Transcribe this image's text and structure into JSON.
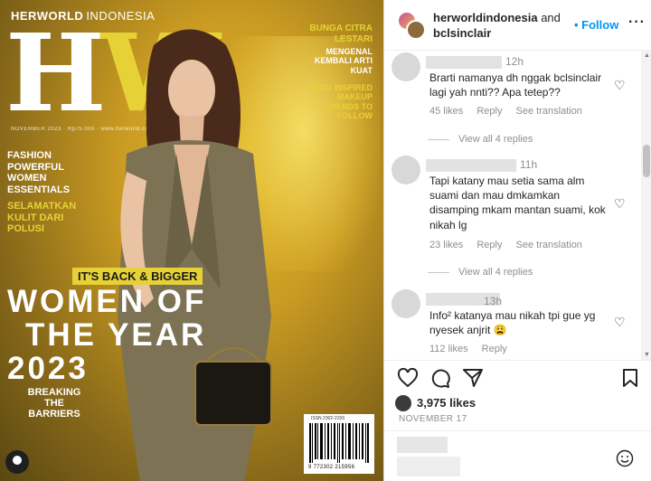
{
  "cover": {
    "brand_top": "HERWORLD",
    "brand_top_light": "INDONESIA",
    "logo_h": "H",
    "logo_w": "W",
    "issue_line": "NOVEMBER 2023 · Rp75.000 · www.herworld.co.id",
    "teaser_right_1": "BUNGA CITRA LESTARI",
    "teaser_right_2": "MENGENAL KEMBALI ARTI KUAT",
    "teaser_right_3": "FOOD INSPIRED MAKEUP TRENDS TO FOLLOW",
    "teaser_left_1a": "FASHION",
    "teaser_left_1b": "POWERFUL WOMEN ESSENTIALS",
    "teaser_left_2": "SELAMATKAN KULIT DARI POLUSI",
    "badge": "IT'S BACK & BIGGER",
    "woty_1": "WOMEN OF",
    "woty_2": "THE YEAR",
    "woty_3": "2023",
    "breaking": "BREAKING THE BARRIERS",
    "issn": "ISSN 2302-2159",
    "barcode_number": "9 772302 215956"
  },
  "header": {
    "account_1": "herworldindonesia",
    "connector": "and",
    "account_2": "bclsinclair",
    "follow_label": "Follow",
    "more_label": "···"
  },
  "comments": [
    {
      "time": "12h",
      "text": "Brarti namanya dh nggak bclsinclair lagi yah nnti?? Apa tetep??",
      "likes": "45 likes",
      "reply": "Reply",
      "translate": "See translation"
    },
    {
      "time": "11h",
      "text": "Tapi katany mau setia sama alm suami dan mau dmkamkan disamping mkam mantan suami, kok nikah lg",
      "likes": "23 likes",
      "reply": "Reply",
      "translate": "See translation"
    },
    {
      "time": "13h",
      "text": "Info² katanya mau nikah tpi gue yg nyesek anjrit 😩",
      "likes": "112 likes",
      "reply": "Reply"
    }
  ],
  "view_replies": [
    "View all 4 replies",
    "View all 4 replies"
  ],
  "post": {
    "likes_count": "3,975 likes",
    "date": "NOVEMBER 17"
  },
  "icons": [
    "heart-icon",
    "comment-icon",
    "share-icon",
    "bookmark-icon",
    "emoji-icon"
  ],
  "colors": {
    "follow": "#0095f6",
    "logo_yellow": "#e6d236",
    "cover_bg": "#c89a22"
  }
}
